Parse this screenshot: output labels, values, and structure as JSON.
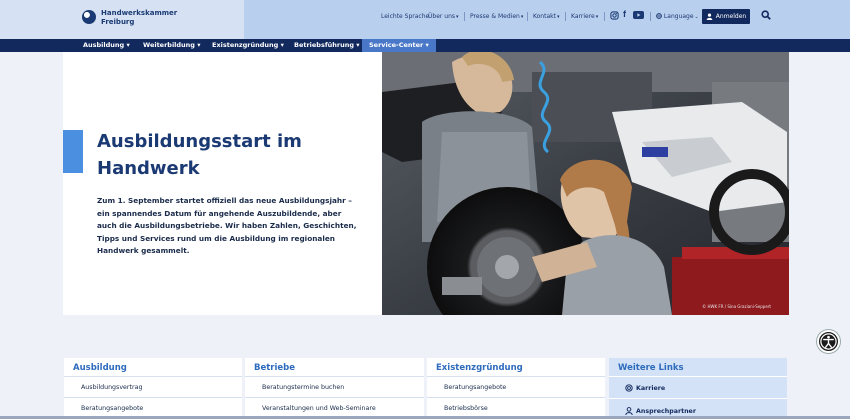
{
  "header": {
    "logo_line1": "Handwerkskammer",
    "logo_line2": "Freiburg",
    "util_nav": [
      {
        "label": "Leichte Sprache",
        "dropdown": false
      },
      {
        "label": "Über uns",
        "dropdown": true
      },
      {
        "label": "Presse & Medien",
        "dropdown": true
      },
      {
        "label": "Kontakt",
        "dropdown": true
      },
      {
        "label": "Karriere",
        "dropdown": true
      }
    ],
    "language_label": "Language",
    "login_label": "Anmelden"
  },
  "main_nav": [
    {
      "label": "Ausbildung ▾"
    },
    {
      "label": "Weiterbildung ▾"
    },
    {
      "label": "Existenzgründung ▾"
    },
    {
      "label": "Betriebsführung ▾"
    },
    {
      "label": "Service-Center ▾"
    }
  ],
  "hero": {
    "title": "Ausbildungsstart im Handwerk",
    "text": "Zum 1. September startet offiziell das neue Ausbildungsjahr – ein spannendes Datum für angehende Auszubildende, aber auch die Ausbildungsbetriebe. Wir haben Zahlen, Geschichten, Tipps und Services rund um die Ausbildung im regionalen Handwerk gesammelt.",
    "image_credit": "© HWK FR / Sina Graziani-Seppert"
  },
  "cards": [
    {
      "title": "Ausbildung",
      "items": [
        "Ausbildungsvertrag",
        "Beratungsangebote"
      ]
    },
    {
      "title": "Betriebe",
      "items": [
        "Beratungstermine buchen",
        "Veranstaltungen und Web-Seminare"
      ]
    },
    {
      "title": "Existenzgründung",
      "items": [
        "Beratungsangebote",
        "Betriebsbörse"
      ]
    }
  ],
  "further_links": {
    "title": "Weitere Links",
    "items": [
      {
        "label": "Karriere",
        "icon": "target-icon"
      },
      {
        "label": "Ansprechpartner",
        "icon": "person-icon"
      }
    ]
  },
  "colors": {
    "navy": "#12295e",
    "accent": "#4a8fe0",
    "active_nav": "#4a78c9"
  }
}
